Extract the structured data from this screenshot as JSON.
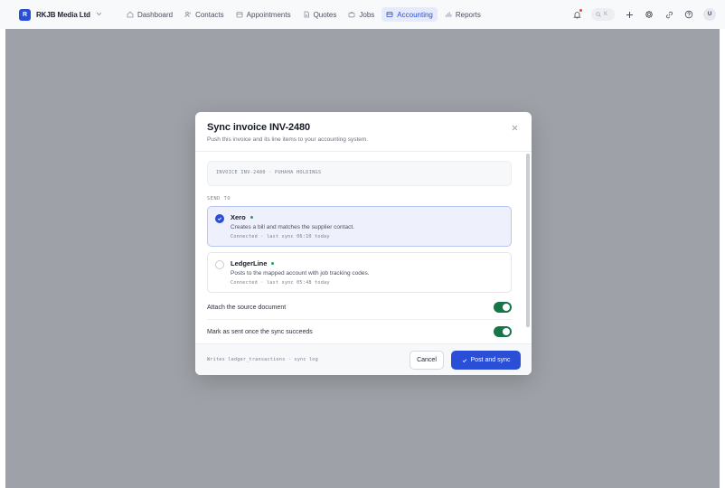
{
  "app": {
    "brand_initial": "R",
    "brand_name": "RKJB Media Ltd"
  },
  "nav": {
    "items": [
      {
        "label": "Dashboard",
        "icon": "home-icon",
        "active": false
      },
      {
        "label": "Contacts",
        "icon": "contacts-icon",
        "active": false
      },
      {
        "label": "Appointments",
        "icon": "calendar-icon",
        "active": false
      },
      {
        "label": "Quotes",
        "icon": "document-icon",
        "active": false
      },
      {
        "label": "Jobs",
        "icon": "briefcase-icon",
        "active": false
      },
      {
        "label": "Accounting",
        "icon": "ledger-icon",
        "active": true
      },
      {
        "label": "Reports",
        "icon": "bar-chart-icon",
        "active": false
      }
    ],
    "search_shortcut": "K",
    "user_initial": "U"
  },
  "modal": {
    "title": "Sync invoice INV-2480",
    "subtitle": "Push this invoice and its line items to your accounting system.",
    "invoice_ref": "INVOICE INV-2480 · PUHAHA HOLDINGS",
    "section_label": "SEND TO",
    "options": [
      {
        "name": "Xero",
        "description": "Creates a bill and matches the supplier contact.",
        "meta": "Connected · last sync 06:10 today",
        "selected": true
      },
      {
        "name": "LedgerLine",
        "description": "Posts to the mapped account with job tracking codes.",
        "meta": "Connected · last sync 05:48 today",
        "selected": false
      }
    ],
    "toggles": [
      {
        "label": "Attach the source document",
        "on": true
      },
      {
        "label": "Mark as sent once the sync succeeds",
        "on": true
      }
    ],
    "footer_note": "Writes ledger_transactions · sync log",
    "cancel_label": "Cancel",
    "submit_label": "Post and sync"
  },
  "colors": {
    "accent": "#2a4fd6",
    "toggle_on": "#17754a",
    "status_connected": "#1fa463",
    "backdrop": "#9ea1a7"
  }
}
